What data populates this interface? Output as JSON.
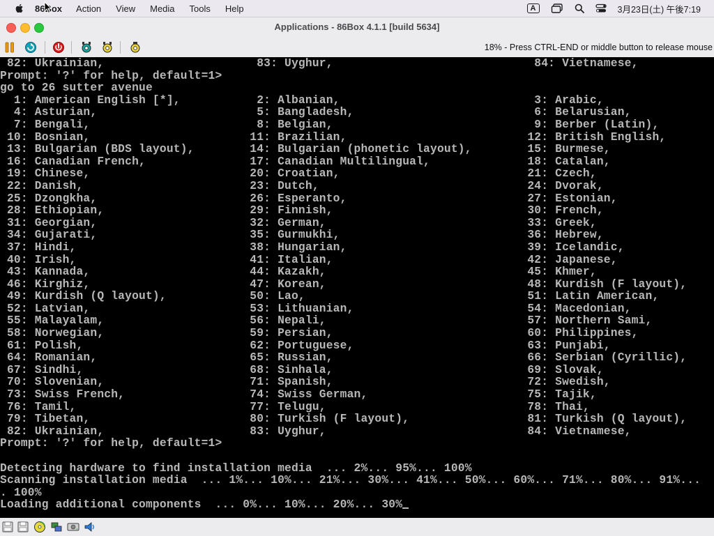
{
  "menubar": {
    "app_name": "86Box",
    "menus": [
      "Action",
      "View",
      "Media",
      "Tools",
      "Help"
    ],
    "input_source": "A",
    "clock": "3月23日(土) 午後7:19"
  },
  "window": {
    "title": "Applications - 86Box 4.1.1 [build 5634]",
    "status_message": "18% - Press CTRL-END or middle button to release mouse"
  },
  "console": {
    "lines": [
      " 82: Ukrainian,                      83: Uyghur,                             84: Vietnamese,",
      "Prompt: '?' for help, default=1>",
      "go to 26 sutter avenue",
      "  1: American English [*],           2: Albanian,                            3: Arabic,",
      "  4: Asturian,                       5: Bangladesh,                          6: Belarusian,",
      "  7: Bengali,                        8: Belgian,                             9: Berber (Latin),",
      " 10: Bosnian,                       11: Brazilian,                          12: British English,",
      " 13: Bulgarian (BDS layout),        14: Bulgarian (phonetic layout),        15: Burmese,",
      " 16: Canadian French,               17: Canadian Multilingual,              18: Catalan,",
      " 19: Chinese,                       20: Croatian,                           21: Czech,",
      " 22: Danish,                        23: Dutch,                              24: Dvorak,",
      " 25: Dzongkha,                      26: Esperanto,                          27: Estonian,",
      " 28: Ethiopian,                     29: Finnish,                            30: French,",
      " 31: Georgian,                      32: German,                             33: Greek,",
      " 34: Gujarati,                      35: Gurmukhi,                           36: Hebrew,",
      " 37: Hindi,                         38: Hungarian,                          39: Icelandic,",
      " 40: Irish,                         41: Italian,                            42: Japanese,",
      " 43: Kannada,                       44: Kazakh,                             45: Khmer,",
      " 46: Kirghiz,                       47: Korean,                             48: Kurdish (F layout),",
      " 49: Kurdish (Q layout),            50: Lao,                                51: Latin American,",
      " 52: Latvian,                       53: Lithuanian,                         54: Macedonian,",
      " 55: Malayalam,                     56: Nepali,                             57: Northern Sami,",
      " 58: Norwegian,                     59: Persian,                            60: Philippines,",
      " 61: Polish,                        62: Portuguese,                         63: Punjabi,",
      " 64: Romanian,                      65: Russian,                            66: Serbian (Cyrillic),",
      " 67: Sindhi,                        68: Sinhala,                            69: Slovak,",
      " 70: Slovenian,                     71: Spanish,                            72: Swedish,",
      " 73: Swiss French,                  74: Swiss German,                       75: Tajik,",
      " 76: Tamil,                         77: Telugu,                             78: Thai,",
      " 79: Tibetan,                       80: Turkish (F layout),                 81: Turkish (Q layout),",
      " 82: Ukrainian,                     83: Uyghur,                             84: Vietnamese,",
      "Prompt: '?' for help, default=1>",
      "",
      "Detecting hardware to find installation media  ... 2%... 95%... 100%",
      "Scanning installation media  ... 1%... 10%... 21%... 30%... 41%... 50%... 60%... 71%... 80%... 91%...",
      ". 100%",
      "Loading additional components  ... 0%... 10%... 20%... 30%"
    ]
  },
  "icons": {
    "toolbar": [
      "pause-icon",
      "ctrl-alt-del-icon",
      "hard-reset-icon",
      "settings-icon",
      "screenshot-icon",
      "media-icon"
    ],
    "statusbar": [
      "floppy-1-icon",
      "floppy-2-icon",
      "cdrom-icon",
      "network-icon",
      "hard-disk-icon",
      "sound-icon"
    ]
  },
  "colors": {
    "console_bg": "#000000",
    "console_fg": "#b8b8b8",
    "close": "#fe5f57",
    "minimize": "#febc2e",
    "maximize": "#28c840"
  }
}
